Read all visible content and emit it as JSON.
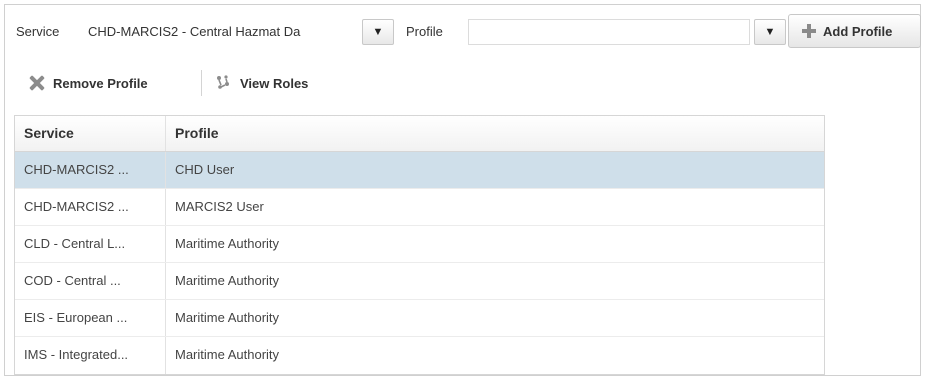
{
  "filters": {
    "service_label": "Service",
    "service_value": "CHD-MARCIS2 - Central Hazmat Da",
    "profile_label": "Profile",
    "profile_value": "",
    "dropdown_glyph": "▼",
    "add_profile_label": "Add Profile"
  },
  "toolbar": {
    "remove_profile_label": "Remove Profile",
    "view_roles_label": "View Roles"
  },
  "table": {
    "columns": [
      "Service",
      "Profile"
    ],
    "rows": [
      {
        "service": "CHD-MARCIS2 ...",
        "profile": "CHD User",
        "selected": true
      },
      {
        "service": "CHD-MARCIS2 ...",
        "profile": "MARCIS2 User",
        "selected": false
      },
      {
        "service": "CLD - Central L...",
        "profile": "Maritime Authority",
        "selected": false
      },
      {
        "service": "COD - Central ...",
        "profile": "Maritime Authority",
        "selected": false
      },
      {
        "service": "EIS - European ...",
        "profile": "Maritime Authority",
        "selected": false
      },
      {
        "service": "IMS - Integrated...",
        "profile": "Maritime Authority",
        "selected": false
      }
    ]
  },
  "colors": {
    "selected_row": "#cfdfea",
    "icon_gray": "#8c8c8c"
  },
  "icons": {
    "add": "plus-icon",
    "remove": "x-icon",
    "view_roles": "roles-icon",
    "dropdown": "chevron-down-icon"
  }
}
